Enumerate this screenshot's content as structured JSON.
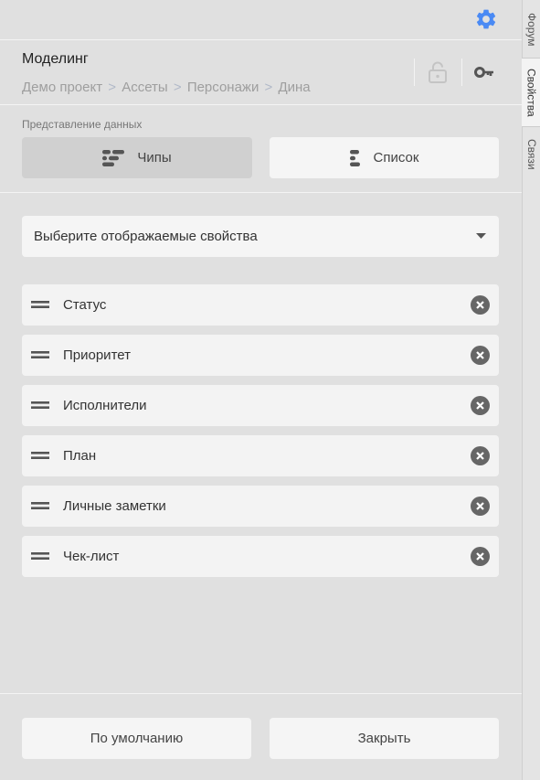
{
  "header": {
    "title": "Моделинг",
    "breadcrumb": [
      "Демо проект",
      "Ассеты",
      "Персонажи",
      "Дина"
    ],
    "breadcrumb_separator": ">"
  },
  "view": {
    "label": "Представление данных",
    "chips_label": "Чипы",
    "list_label": "Список",
    "selected": "chips"
  },
  "properties_select": {
    "placeholder": "Выберите отображаемые свойства"
  },
  "properties": [
    "Статус",
    "Приоритет",
    "Исполнители",
    "План",
    "Личные заметки",
    "Чек-лист"
  ],
  "footer": {
    "default_label": "По умолчанию",
    "close_label": "Закрыть"
  },
  "side_tabs": [
    "Форум",
    "Свойства",
    "Связи"
  ],
  "active_side_tab": "Свойства",
  "colors": {
    "accent": "#4a8af4",
    "remove_icon": "#666666",
    "icon_gray": "#555555"
  }
}
